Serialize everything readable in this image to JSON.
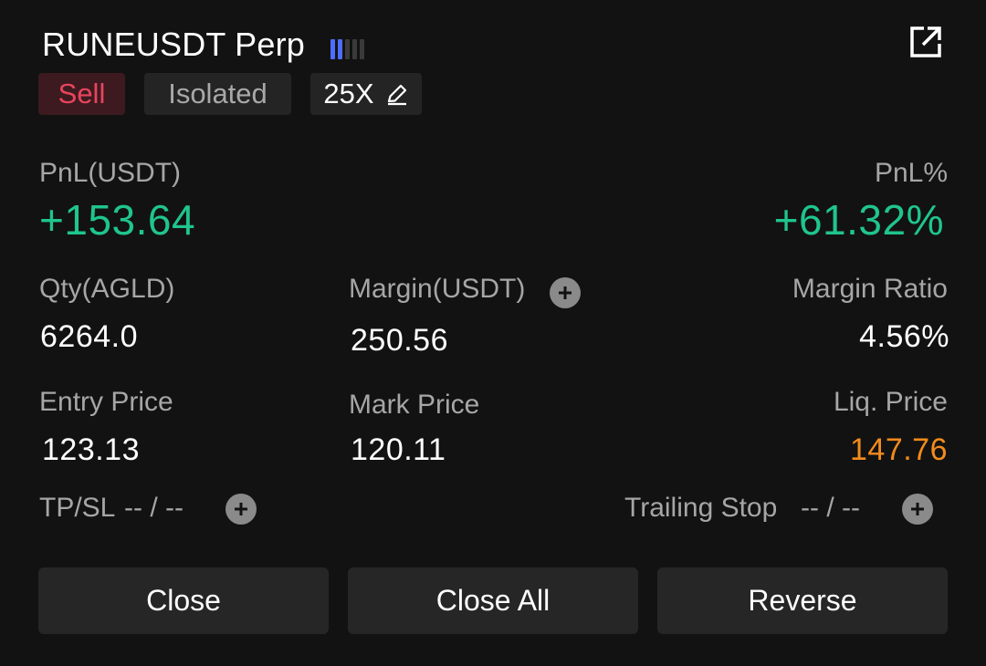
{
  "header": {
    "title": "RUNEUSDT Perp",
    "signal_icon": "signal-bars-icon",
    "signal_level": 2,
    "signal_colors": {
      "active": "#4d6dff",
      "inactive": "#3a3a3a"
    },
    "share_icon": "share-external-icon"
  },
  "tags": {
    "side": "Sell",
    "margin_mode": "Isolated",
    "leverage": "25X",
    "leverage_icon": "edit-pencil-icon"
  },
  "pnl": {
    "label": "PnL(USDT)",
    "value": "+153.64",
    "pct_label": "PnL%",
    "pct_value": "+61.32%"
  },
  "stats": {
    "qty_label": "Qty(AGLD)",
    "qty_value": "6264.0",
    "margin_label": "Margin(USDT)",
    "margin_value": "250.56",
    "margin_ratio_label": "Margin Ratio",
    "margin_ratio_value": "4.56%",
    "entry_label": "Entry Price",
    "entry_value": "123.13",
    "mark_label": "Mark Price",
    "mark_value": "120.11",
    "liq_label": "Liq. Price",
    "liq_value": "147.76"
  },
  "orders": {
    "tpsl_label": "TP/SL",
    "tpsl_value": "-- / --",
    "trailing_label": "Trailing Stop",
    "trailing_value": "-- / --"
  },
  "actions": {
    "close": "Close",
    "close_all": "Close All",
    "reverse": "Reverse"
  },
  "colors": {
    "background": "#121212",
    "profit_green": "#1fc58e",
    "sell_red": "#e8455c",
    "liq_orange": "#f28b1c"
  }
}
